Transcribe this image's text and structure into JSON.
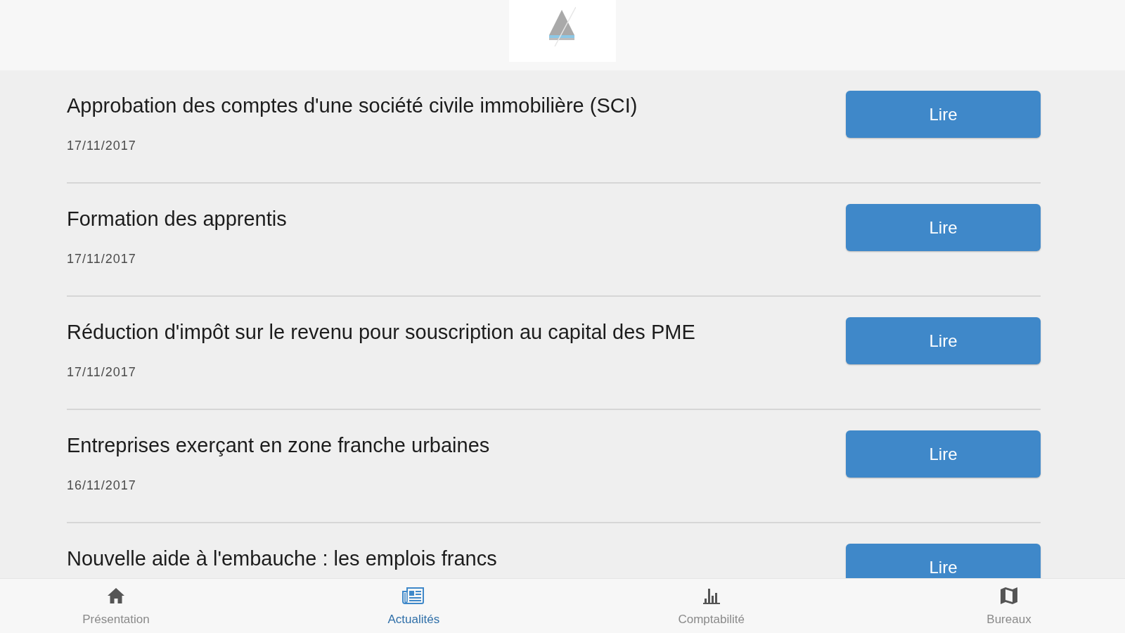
{
  "articles": [
    {
      "title": "Approbation des comptes d'une société civile immobilière (SCI)",
      "date": "17/11/2017",
      "button": "Lire"
    },
    {
      "title": "Formation des apprentis",
      "date": "17/11/2017",
      "button": "Lire"
    },
    {
      "title": "Réduction d'impôt sur le revenu pour souscription au capital des PME",
      "date": "17/11/2017",
      "button": "Lire"
    },
    {
      "title": "Entreprises exerçant en zone franche urbaines",
      "date": "16/11/2017",
      "button": "Lire"
    },
    {
      "title": "Nouvelle aide à l'embauche : les emplois francs",
      "button": "Lire"
    }
  ],
  "nav": [
    {
      "label": "Présentation",
      "selected": false
    },
    {
      "label": "Actualités",
      "selected": true
    },
    {
      "label": "Comptabilité",
      "selected": false
    },
    {
      "label": "Bureaux",
      "selected": false
    }
  ]
}
